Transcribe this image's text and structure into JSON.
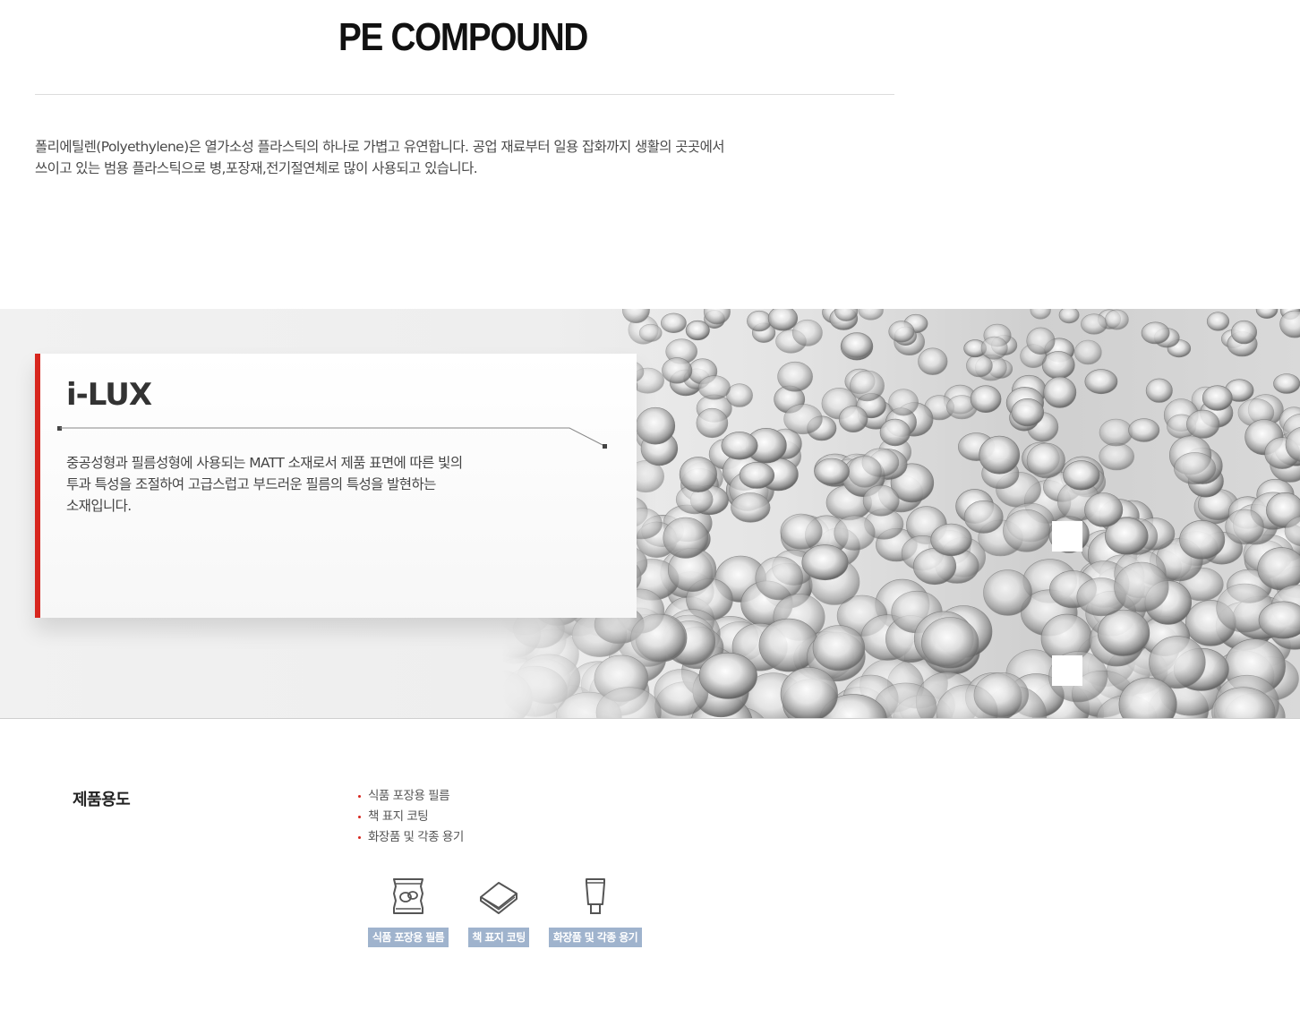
{
  "page_title": "PE COMPOUND",
  "intro": {
    "line1": "폴리에틸렌(Polyethylene)은 열가소성 플라스틱의 하나로 가볍고 유연합니다. 공업 재료부터 일용 잡화까지 생활의 곳곳에서",
    "line2": "쓰이고 있는 범용 플라스틱으로 병,포장재,전기절연체로 많이 사용되고 있습니다."
  },
  "feature": {
    "title": "i-LUX",
    "desc_line1": "중공성형과 필름성형에 사용되는 MATT 소재로서 제품 표면에 따른 빛의",
    "desc_line2": "투과 특성을 조절하여 고급스럽고 부드러운 필름의 특성을 발현하는",
    "desc_line3": "소재입니다.",
    "accent_color": "#d7261e"
  },
  "slider": {
    "prev_icon": "prev-arrow-icon",
    "next_icon": "next-arrow-icon"
  },
  "usage": {
    "heading": "제품용도",
    "items": [
      "식품 포장용 필름",
      "책 표지 코팅",
      "화장품 및 각종 용기"
    ],
    "icons": [
      {
        "name": "food-package-icon",
        "label": "식품 포장용 필름"
      },
      {
        "name": "book-cover-icon",
        "label": "책 표지 코팅"
      },
      {
        "name": "cosmetic-tube-icon",
        "label": "화장품 및 각종 용기"
      }
    ],
    "badge_color": "#9fb3cd"
  }
}
